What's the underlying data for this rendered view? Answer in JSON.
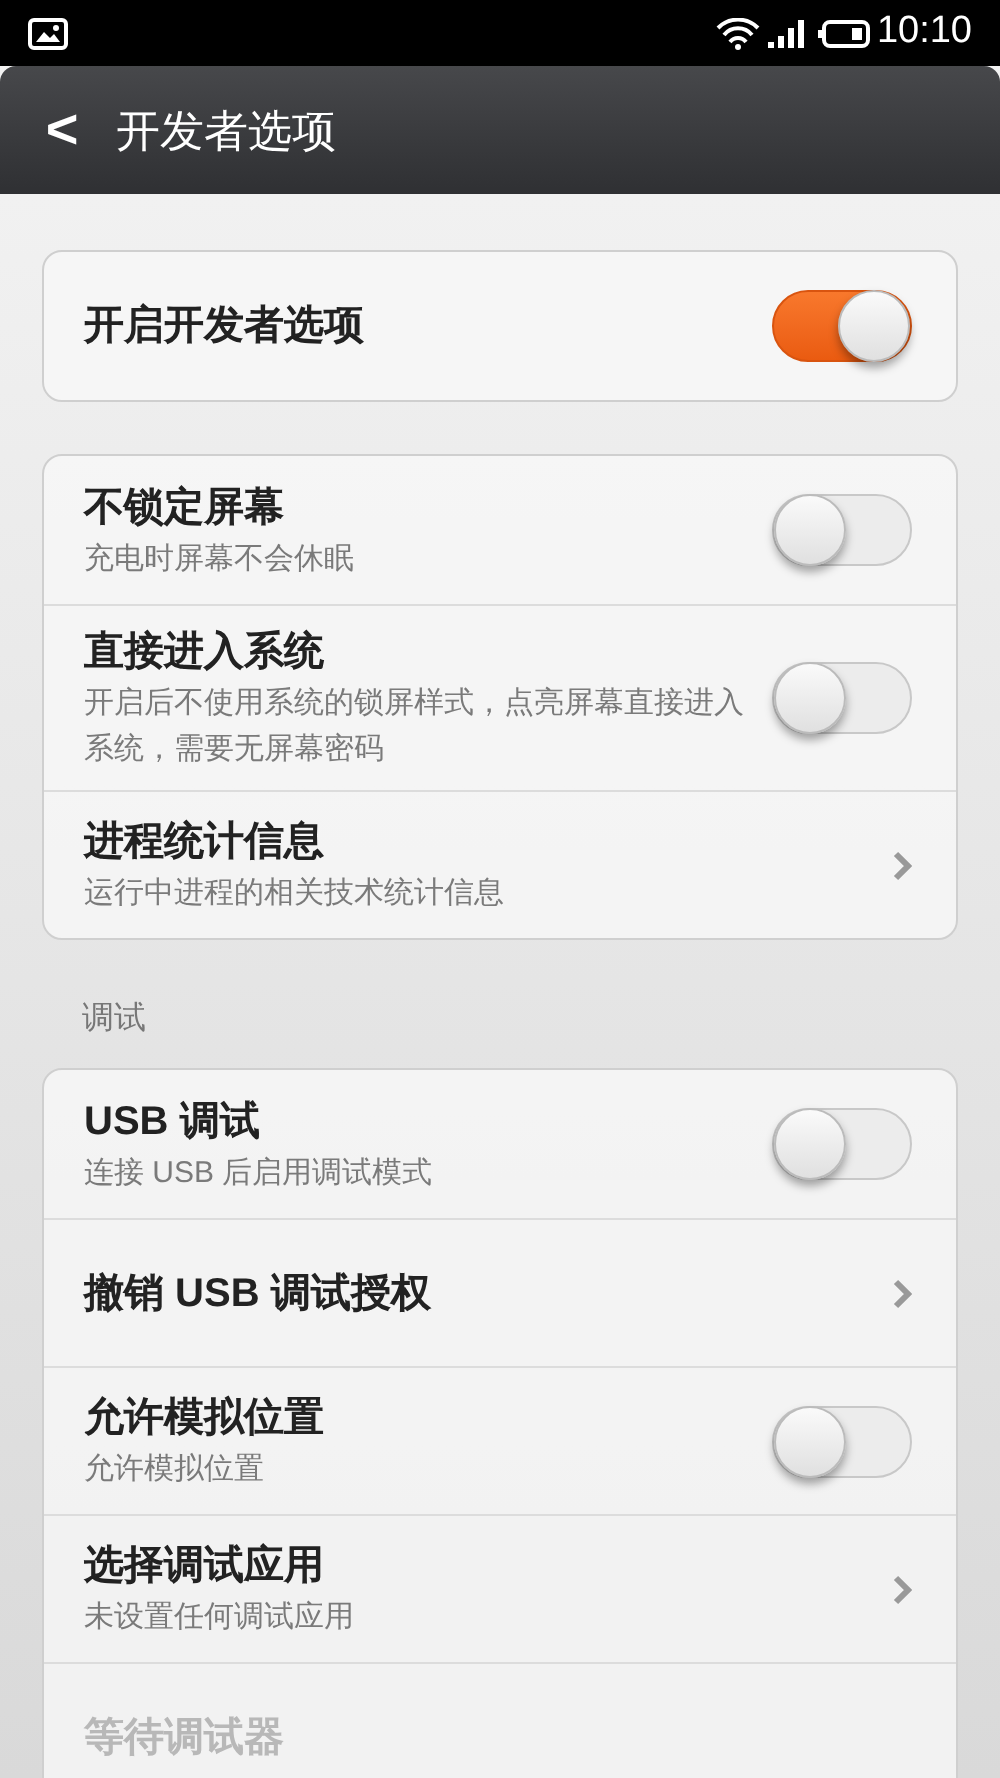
{
  "status_bar": {
    "time": "10:10"
  },
  "header": {
    "back": "<",
    "title": "开发者选项"
  },
  "sections": [
    {
      "items": [
        {
          "kind": "toggle",
          "title": "开启开发者选项",
          "on": true,
          "disabled": false
        }
      ]
    },
    {
      "items": [
        {
          "kind": "toggle",
          "title": "不锁定屏幕",
          "subtitle": "充电时屏幕不会休眠",
          "on": false,
          "disabled": false
        },
        {
          "kind": "toggle",
          "title": "直接进入系统",
          "subtitle": "开启后不使用系统的锁屏样式，点亮屏幕直接进入系统，需要无屏幕密码",
          "on": false,
          "disabled": false
        },
        {
          "kind": "link",
          "title": "进程统计信息",
          "subtitle": "运行中进程的相关技术统计信息",
          "disabled": false
        }
      ]
    },
    {
      "header": "调试",
      "items": [
        {
          "kind": "toggle",
          "title": "USB 调试",
          "subtitle": "连接 USB 后启用调试模式",
          "on": false,
          "disabled": false
        },
        {
          "kind": "link",
          "title": "撤销 USB 调试授权",
          "disabled": false
        },
        {
          "kind": "toggle",
          "title": "允许模拟位置",
          "subtitle": "允许模拟位置",
          "on": false,
          "disabled": false
        },
        {
          "kind": "link",
          "title": "选择调试应用",
          "subtitle": "未设置任何调试应用",
          "disabled": false
        },
        {
          "kind": "link",
          "title": "等待调试器",
          "disabled": true
        }
      ]
    }
  ]
}
